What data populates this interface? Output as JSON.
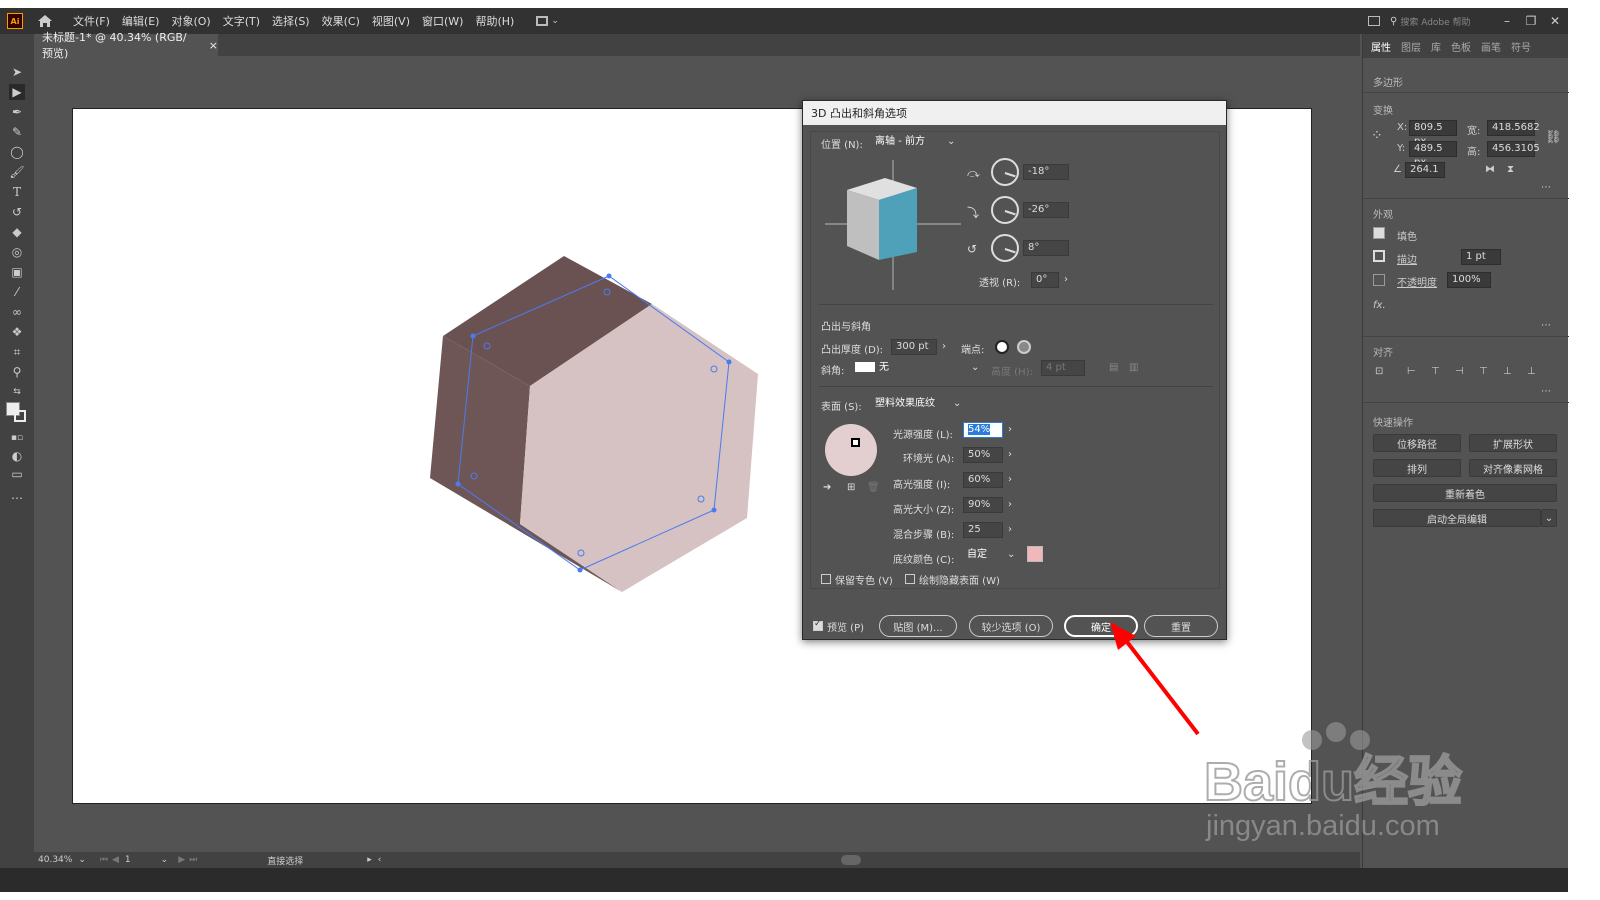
{
  "menubar": {
    "logo": "Ai",
    "items": [
      "文件(F)",
      "编辑(E)",
      "对象(O)",
      "文字(T)",
      "选择(S)",
      "效果(C)",
      "视图(V)",
      "窗口(W)",
      "帮助(H)"
    ],
    "search_placeholder": "搜索 Adobe 帮助"
  },
  "document_tab": {
    "title": "未标题-1* @ 40.34% (RGB/预览)",
    "close": "×"
  },
  "right_panel": {
    "tabs": [
      "属性",
      "图层",
      "库",
      "色板",
      "画笔",
      "符号"
    ],
    "object_type": "多边形",
    "transform_title": "变换",
    "x_label": "X:",
    "x_value": "809.5 px",
    "y_label": "Y:",
    "y_value": "489.5 px",
    "w_label": "宽:",
    "w_value": "418.5682",
    "h_label": "高:",
    "h_value": "456.3105",
    "angle_value": "264.1",
    "appearance_title": "外观",
    "fill_label": "填色",
    "stroke_label": "描边",
    "stroke_value": "1 pt",
    "opacity_label": "不透明度",
    "opacity_value": "100%",
    "fx_label": "fx.",
    "align_title": "对齐",
    "quick_title": "快速操作",
    "btn_offset_path": "位移路径",
    "btn_expand_shape": "扩展形状",
    "btn_arrange": "排列",
    "btn_pixel_grid": "对齐像素网格",
    "btn_recolor": "重新着色",
    "btn_global_edit": "启动全局编辑"
  },
  "dialog": {
    "title": "3D 凸出和斜角选项",
    "position_label": "位置 (N):",
    "position_value": "离轴 - 前方",
    "rot_x": "-18°",
    "rot_y": "-26°",
    "rot_z": "8°",
    "perspective_label": "透视 (R):",
    "perspective_value": "0°",
    "extrude_title": "凸出与斜角",
    "depth_label": "凸出厚度 (D):",
    "depth_value": "300 pt",
    "cap_label": "端点:",
    "bevel_label": "斜角:",
    "bevel_value": "无",
    "height_label": "高度 (H):",
    "height_value": "4 pt",
    "surface_label": "表面 (S):",
    "surface_value": "塑料效果底纹",
    "light_intensity_label": "光源强度 (L):",
    "light_intensity_value": "54%",
    "ambient_label": "环境光 (A):",
    "ambient_value": "50%",
    "highlight_intensity_label": "高光强度 (I):",
    "highlight_intensity_value": "60%",
    "highlight_size_label": "高光大小 (Z):",
    "highlight_size_value": "90%",
    "blend_steps_label": "混合步骤 (B):",
    "blend_steps_value": "25",
    "shade_color_label": "底纹颜色 (C):",
    "shade_color_value": "自定",
    "preserve_spot_label": "保留专色 (V)",
    "draw_hidden_label": "绘制隐藏表面 (W)",
    "preview_label": "预览 (P)",
    "btn_map": "贴图 (M)...",
    "btn_fewer": "较少选项 (O)",
    "btn_ok": "确定",
    "btn_reset": "重置"
  },
  "statusbar": {
    "zoom": "40.34%",
    "page": "1",
    "tool": "直接选择"
  },
  "watermark": {
    "brand": "Baidu经验",
    "url": "jingyan.baidu.com"
  },
  "colors": {
    "shape_top": "#6b5252",
    "shape_side": "#6f5656",
    "shape_front": "#d6c2c2",
    "cube_front": "#4ea1b8",
    "shade_swatch": "#f0b8b8",
    "arrow": "#ff0000",
    "selection": "#4a7bf0"
  }
}
